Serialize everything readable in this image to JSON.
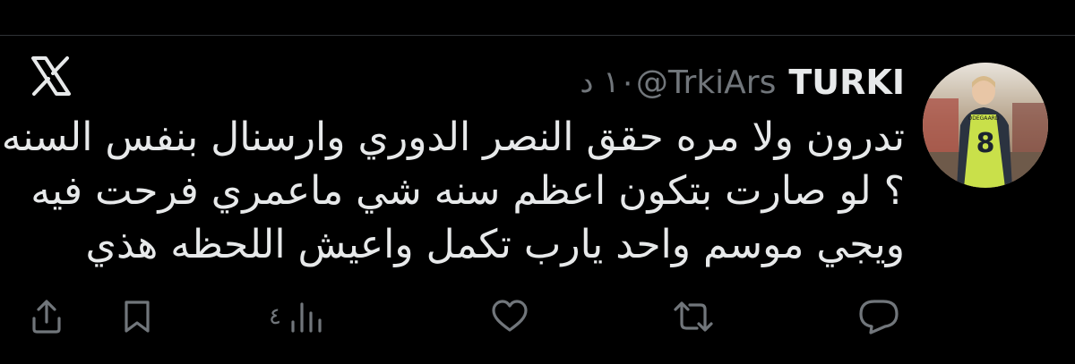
{
  "tweet": {
    "display_name": "TURKI",
    "handle": "@TrkiArs",
    "timestamp": "١٠ د",
    "lines": [
      "تدرون ولا مره حقق النصر الدوري وارسنال بنفس السنه",
      "؟ لو صارت بتكون اعظم سنه شي ماعمري فرحت فيه",
      "ويجي موسم واحد يارب تكمل واعيش اللحظه هذي"
    ],
    "avatar_jersey_text": "ODEGAARD",
    "avatar_jersey_number": "8"
  },
  "actions": {
    "views_count": "٤"
  },
  "icons": {
    "platform": "x-logo-icon",
    "reply": "reply-bubble-icon",
    "retweet": "retweet-icon",
    "like": "heart-icon",
    "views": "analytics-bars-icon",
    "bookmark": "bookmark-icon",
    "share": "share-upload-icon"
  },
  "colors": {
    "background": "#000000",
    "primary_text": "#e7e9ea",
    "secondary_text": "#71767b",
    "divider": "#2f3336"
  }
}
